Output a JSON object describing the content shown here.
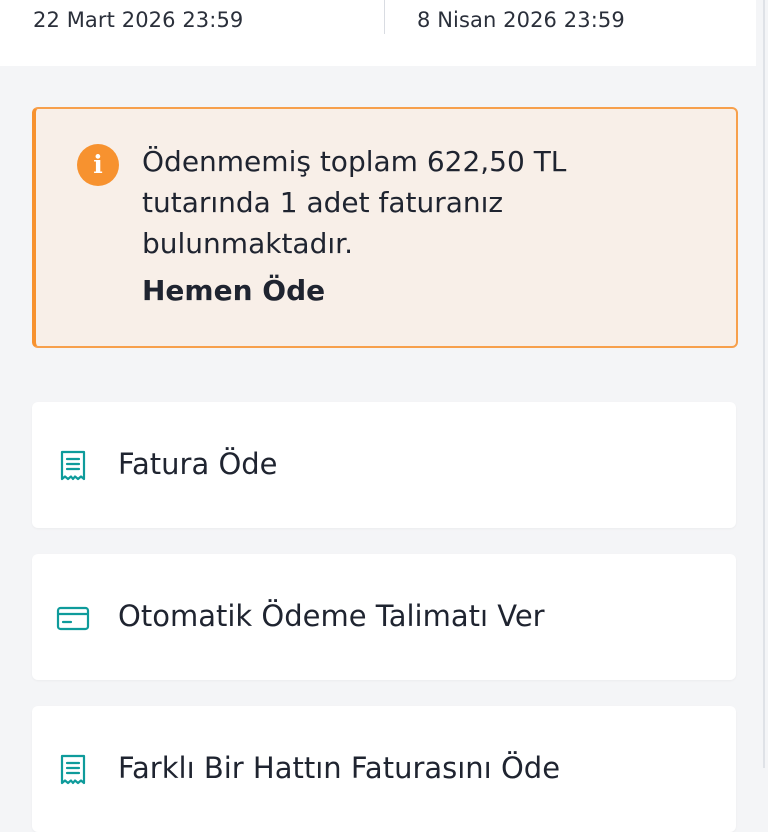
{
  "date_range": {
    "start": "22 Mart 2026 23:59",
    "end": "8 Nisan 2026 23:59"
  },
  "alert": {
    "icon": "info-icon",
    "message": "Ödenmemiş toplam 622,50 TL tutarında 1 adet faturanız bulunmaktadır.",
    "action_label": "Hemen Öde",
    "accent_color": "#f7922f",
    "background_color": "#f8efe8"
  },
  "menu": {
    "items": [
      {
        "label": "Fatura Öde",
        "icon": "receipt-icon"
      },
      {
        "label": "Otomatik Ödeme Talimatı Ver",
        "icon": "credit-card-icon"
      },
      {
        "label": "Farklı Bir Hattın Faturasını Öde",
        "icon": "receipt-icon"
      }
    ]
  },
  "colors": {
    "icon_teal": "#0e9b9b",
    "text": "#1f2430"
  }
}
